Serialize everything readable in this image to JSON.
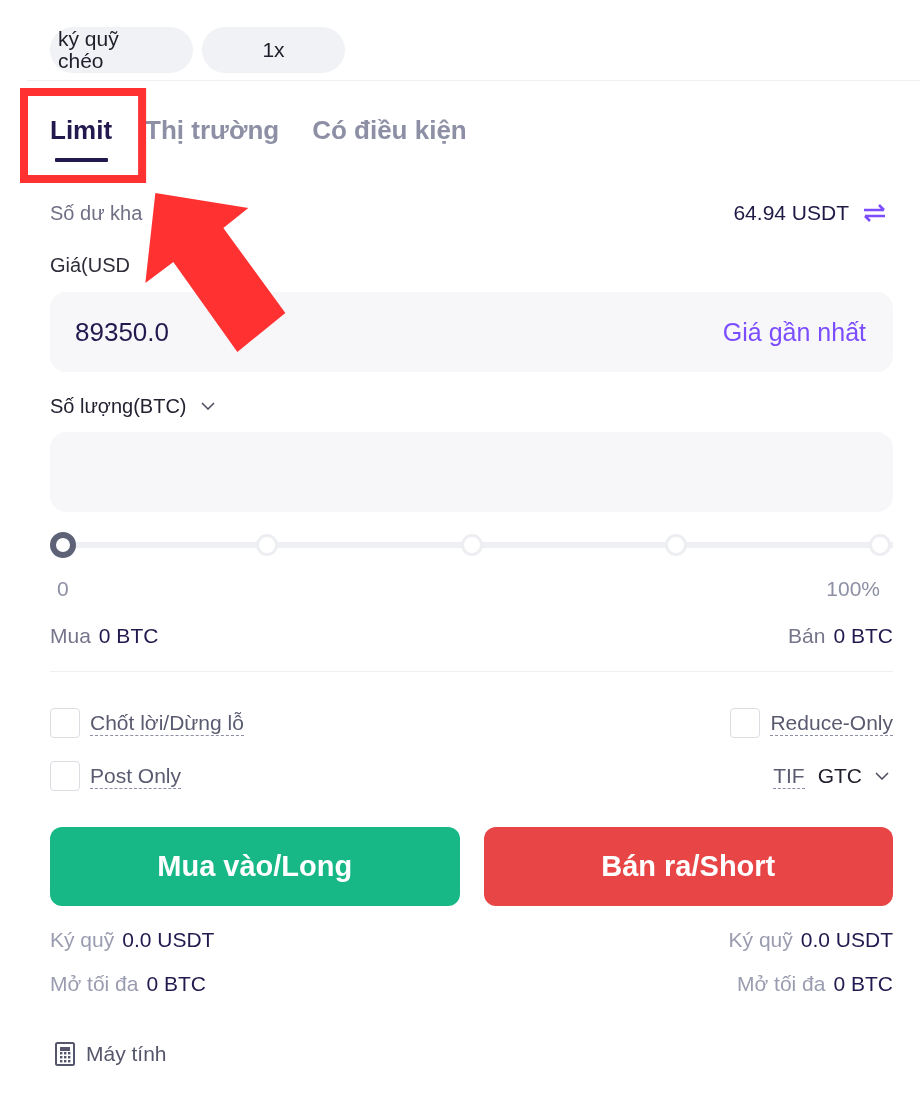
{
  "margin_controls": [
    {
      "label": "ký quỹ chéo"
    },
    {
      "label": "1x"
    }
  ],
  "order_tabs": [
    {
      "label": "Limit",
      "selected": true,
      "highlighted": true
    },
    {
      "label": "Thị trường",
      "selected": false,
      "highlighted": false
    },
    {
      "label": "Có điều kiện",
      "selected": false,
      "highlighted": false
    }
  ],
  "balance": {
    "label": "Số dư kha",
    "value": "64.94 USDT"
  },
  "price": {
    "label": "Giá(USD",
    "value": "89350.0",
    "action": "Giá gần nhất"
  },
  "quantity": {
    "label": "Số lượng(BTC)"
  },
  "slider": {
    "level": 0,
    "min_label": "0",
    "max_label": "100%"
  },
  "amounts": [
    {
      "label": "Mua",
      "value": "0 BTC"
    },
    {
      "label": "Bán",
      "value": "0 BTC"
    }
  ],
  "options": [
    {
      "kind": "checkbox",
      "label": "Chốt lời/Dừng lỗ",
      "checked": false
    },
    {
      "kind": "checkbox",
      "label": "Reduce-Only",
      "checked": false
    },
    {
      "kind": "checkbox",
      "label": "Post Only",
      "checked": false
    },
    {
      "kind": "select",
      "label": "TIF",
      "value": "GTC"
    }
  ],
  "actions": [
    {
      "kind": "buy",
      "label": "Mua vào/Long",
      "details": [
        {
          "label": "Ký quỹ",
          "value": "0.0 USDT"
        },
        {
          "label": "Mở tối đa",
          "value": "0 BTC"
        }
      ]
    },
    {
      "kind": "sell",
      "label": "Bán ra/Short",
      "details": [
        {
          "label": "Ký quỹ",
          "value": "0.0 USDT"
        },
        {
          "label": "Mở tối đa",
          "value": "0 BTC"
        }
      ]
    }
  ],
  "calculator": {
    "label": "Máy tính"
  }
}
